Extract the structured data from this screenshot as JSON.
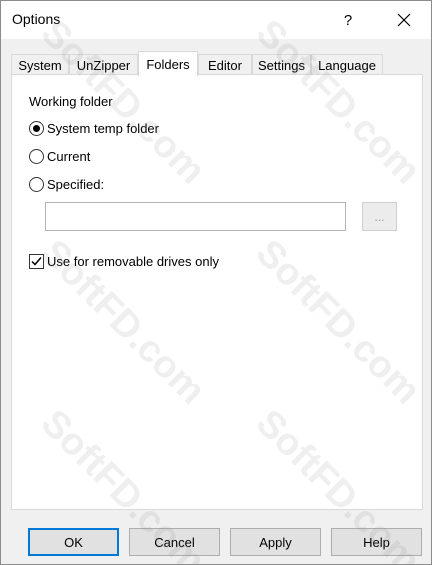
{
  "window": {
    "title": "Options",
    "help_label": "?",
    "close_icon": "close-icon"
  },
  "tabs": [
    {
      "label": "System",
      "active": false
    },
    {
      "label": "UnZipper",
      "active": false
    },
    {
      "label": "Folders",
      "active": true
    },
    {
      "label": "Editor",
      "active": false
    },
    {
      "label": "Settings",
      "active": false
    },
    {
      "label": "Language",
      "active": false
    }
  ],
  "folders": {
    "group_label": "Working folder",
    "options": [
      {
        "label": "System temp folder",
        "checked": true
      },
      {
        "label": "Current",
        "checked": false
      },
      {
        "label": "Specified:",
        "checked": false
      }
    ],
    "path_value": "",
    "browse_label": "...",
    "removable_label": "Use for removable drives only",
    "removable_checked": true
  },
  "buttons": {
    "ok": "OK",
    "cancel": "Cancel",
    "apply": "Apply",
    "help": "Help"
  },
  "watermark": "SoftFD.com",
  "colors": {
    "accent": "#0078d7",
    "panel": "#ffffff",
    "window": "#f0f0f0"
  }
}
